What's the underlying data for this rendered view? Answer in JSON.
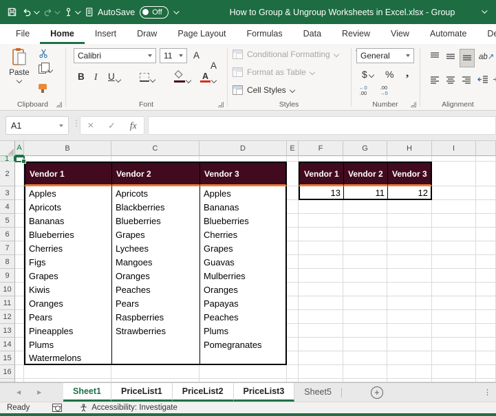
{
  "colors": {
    "titlebar_green": "#1E6C41",
    "brand_green": "#1E7145",
    "table_header_bg": "#420A1E",
    "accent_orange": "#ED7D31",
    "fill_swatch": "#420A1E",
    "font_color_swatch": "#D92B20"
  },
  "title_bar": {
    "autosave_label": "AutoSave",
    "autosave_state": "Off",
    "document_title": "How to Group & Ungroup Worksheets in Excel.xlsx  -  Group"
  },
  "ribbon": {
    "tabs": [
      {
        "label": "File",
        "active": false
      },
      {
        "label": "Home",
        "active": true
      },
      {
        "label": "Insert",
        "active": false
      },
      {
        "label": "Draw",
        "active": false
      },
      {
        "label": "Page Layout",
        "active": false
      },
      {
        "label": "Formulas",
        "active": false
      },
      {
        "label": "Data",
        "active": false
      },
      {
        "label": "Review",
        "active": false
      },
      {
        "label": "View",
        "active": false
      },
      {
        "label": "Automate",
        "active": false
      },
      {
        "label": "De",
        "active": false
      }
    ],
    "clipboard": {
      "label": "Clipboard",
      "paste_label": "Paste"
    },
    "font": {
      "label": "Font",
      "font_name": "Calibri",
      "font_size": "11",
      "bold": "B",
      "italic": "I",
      "underline": "U"
    },
    "styles": {
      "label": "Styles",
      "conditional_formatting": "Conditional Formatting",
      "format_as_table": "Format as Table",
      "cell_styles": "Cell Styles"
    },
    "number": {
      "label": "Number",
      "format": "General",
      "currency": "$",
      "percent": "%",
      "comma": ",",
      "increase_decimal_top": "←0",
      "increase_decimal_bottom": ".00",
      "decrease_decimal_top": ".00",
      "decrease_decimal_bottom": "→0"
    },
    "alignment": {
      "label": "Alignment",
      "orientation_text": "ab",
      "orientation_arrow": "↗"
    }
  },
  "formula_bar": {
    "name_box": "A1",
    "cancel_glyph": "×",
    "enter_glyph": "✓",
    "function_label": "fx",
    "formula_value": ""
  },
  "grid": {
    "column_headers": [
      "A",
      "B",
      "C",
      "D",
      "E",
      "F",
      "G",
      "H",
      "I",
      ""
    ],
    "row_count": 16,
    "active_cell": "A1"
  },
  "worksheet": {
    "left_table": {
      "headers": [
        "Vendor 1",
        "Vendor 2",
        "Vendor 3"
      ],
      "columns": [
        [
          "Apples",
          "Apricots",
          "Bananas",
          "Blueberries",
          "Cherries",
          "Figs",
          "Grapes",
          "Kiwis",
          "Oranges",
          "Pears",
          "Pineapples",
          "Plums",
          "Watermelons"
        ],
        [
          "Apricots",
          "Blackberries",
          "Blueberries",
          "Grapes",
          "Lychees",
          "Mangoes",
          "Oranges",
          "Peaches",
          "Pears",
          "Raspberries",
          "Strawberries"
        ],
        [
          "Apples",
          "Bananas",
          "Blueberries",
          "Cherries",
          "Grapes",
          "Guavas",
          "Mulberries",
          "Oranges",
          "Papayas",
          "Peaches",
          "Plums",
          "Pomegranates"
        ]
      ]
    },
    "right_table": {
      "headers": [
        "Vendor 1",
        "Vendor 2",
        "Vendor 3"
      ],
      "values": [
        "13",
        "11",
        "12"
      ]
    }
  },
  "sheet_tabs": {
    "tabs": [
      {
        "name": "Sheet1",
        "grouped": true,
        "active": true
      },
      {
        "name": "PriceList1",
        "grouped": true,
        "active": false
      },
      {
        "name": "PriceList2",
        "grouped": true,
        "active": false
      },
      {
        "name": "PriceList3",
        "grouped": true,
        "active": false
      },
      {
        "name": "Sheet5",
        "grouped": false,
        "active": false
      }
    ]
  },
  "status_bar": {
    "mode": "Ready",
    "accessibility_label": "Accessibility: Investigate"
  }
}
